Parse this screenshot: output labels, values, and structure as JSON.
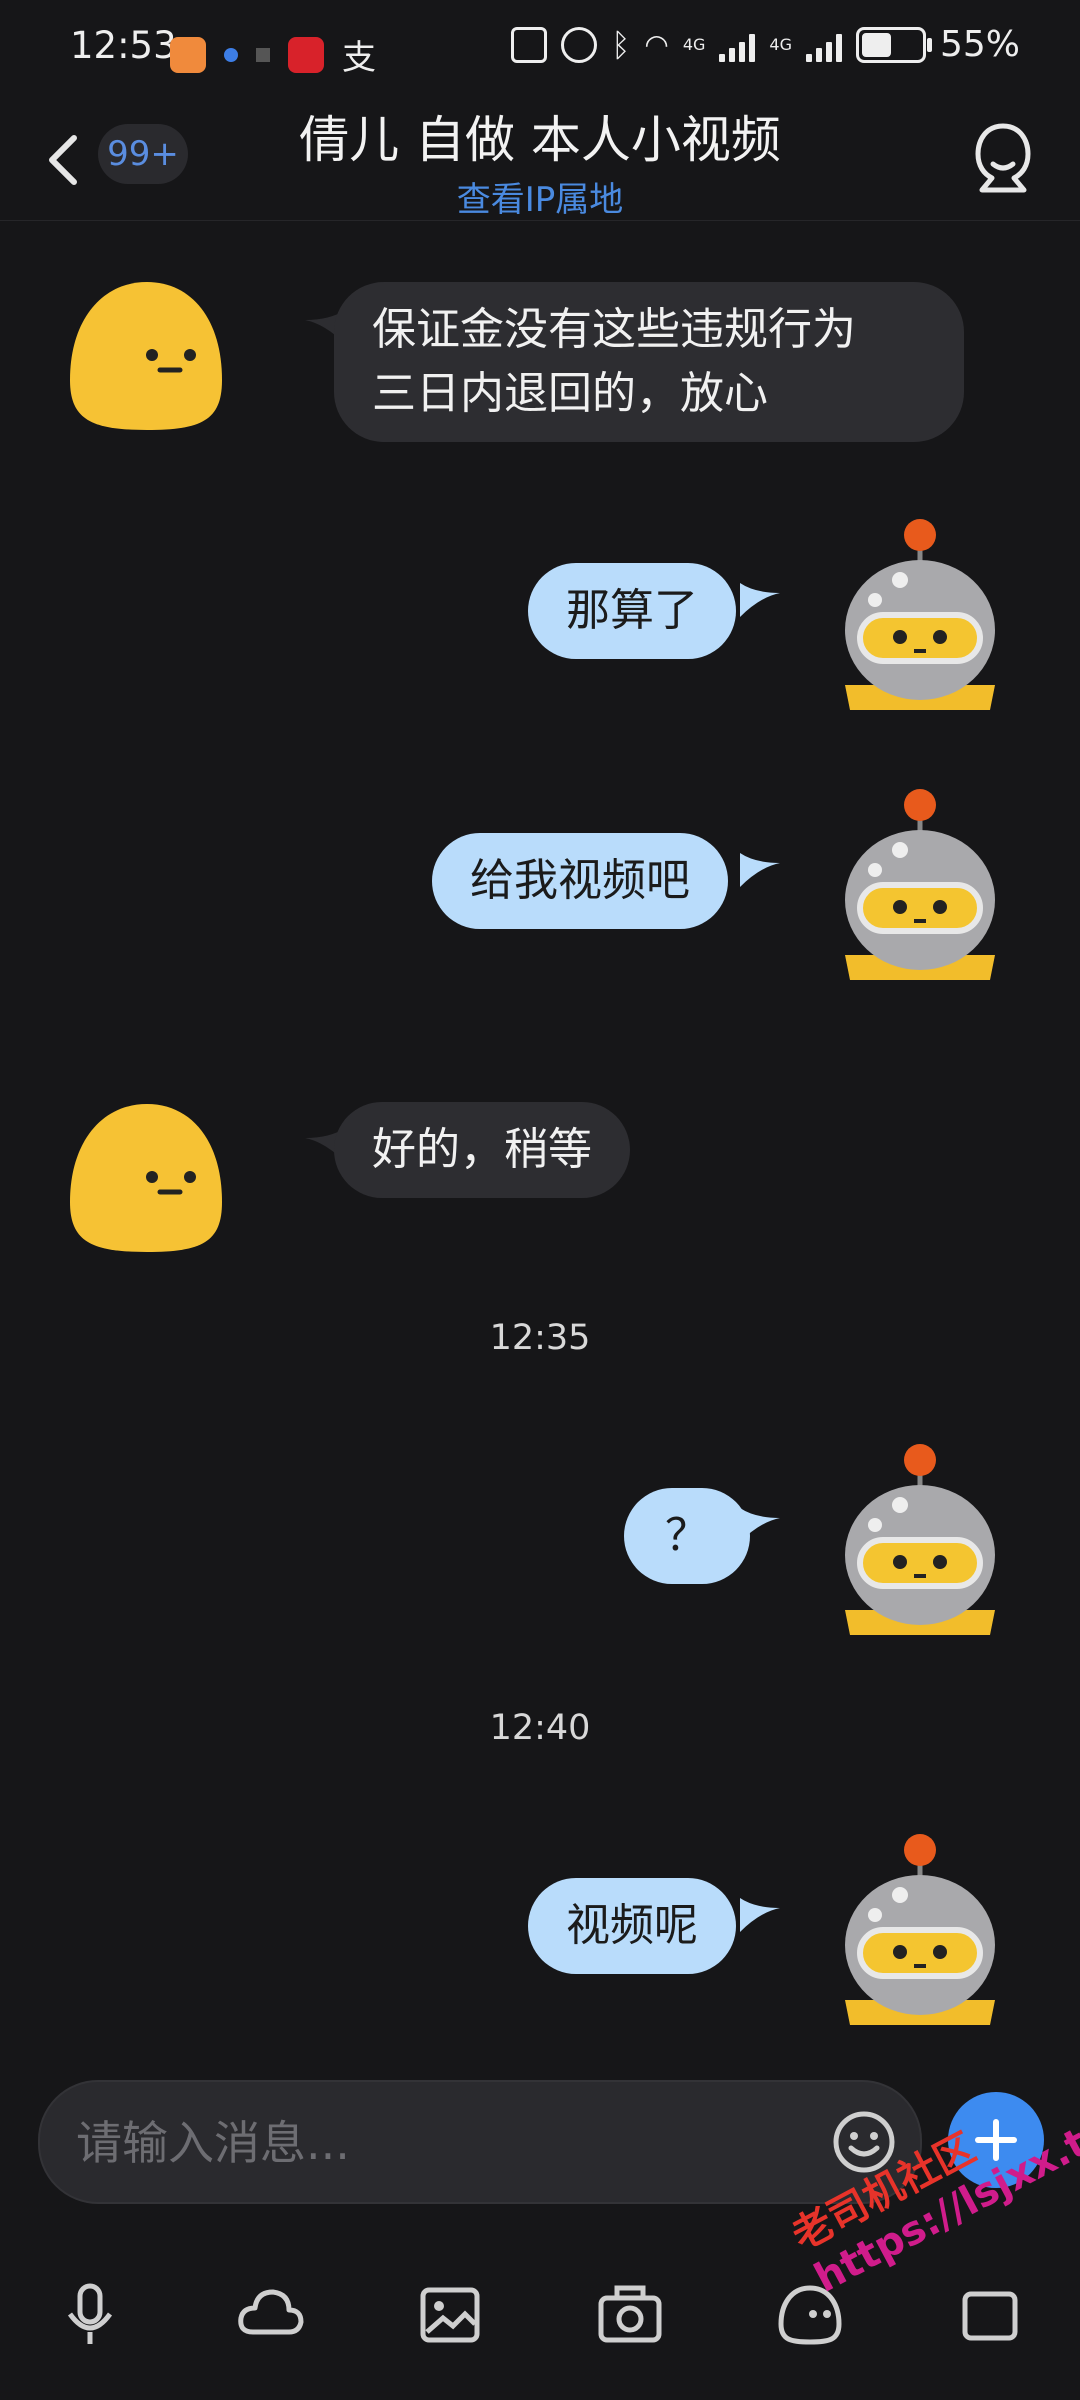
{
  "status_bar": {
    "time": "12:53",
    "network_label_1": "4G",
    "network_label_2": "4G",
    "battery": "55%",
    "battery_level": 0.55
  },
  "header": {
    "title": "倩儿 自做 本人小视频",
    "subtitle": "查看IP属地",
    "unread_badge": "99+"
  },
  "messages": [
    {
      "direction": "in",
      "text_line1": "保证金没有这些违规行为",
      "text_line2": "三日内退回的，放心"
    },
    {
      "direction": "out",
      "text": "那算了"
    },
    {
      "direction": "out",
      "text": "给我视频吧"
    },
    {
      "direction": "in",
      "text": "好的，稍等"
    },
    {
      "timestamp": "12:35"
    },
    {
      "direction": "out",
      "text": "？"
    },
    {
      "timestamp": "12:40"
    },
    {
      "direction": "out",
      "text": "视频呢"
    }
  ],
  "input": {
    "placeholder": "请输入消息..."
  },
  "toolbar": {
    "items": [
      "mic-icon",
      "cloud-icon",
      "image-icon",
      "camera-icon",
      "sticker-icon",
      "more-icon"
    ]
  },
  "watermark": {
    "line1": "老司机社区",
    "line2": "https://lsjxx.top"
  },
  "colors": {
    "background": "#161618",
    "incoming_bubble": "#2d2d31",
    "outgoing_bubble": "#b9dcfb",
    "accent": "#3d8bf0",
    "link": "#4a8ae0"
  }
}
